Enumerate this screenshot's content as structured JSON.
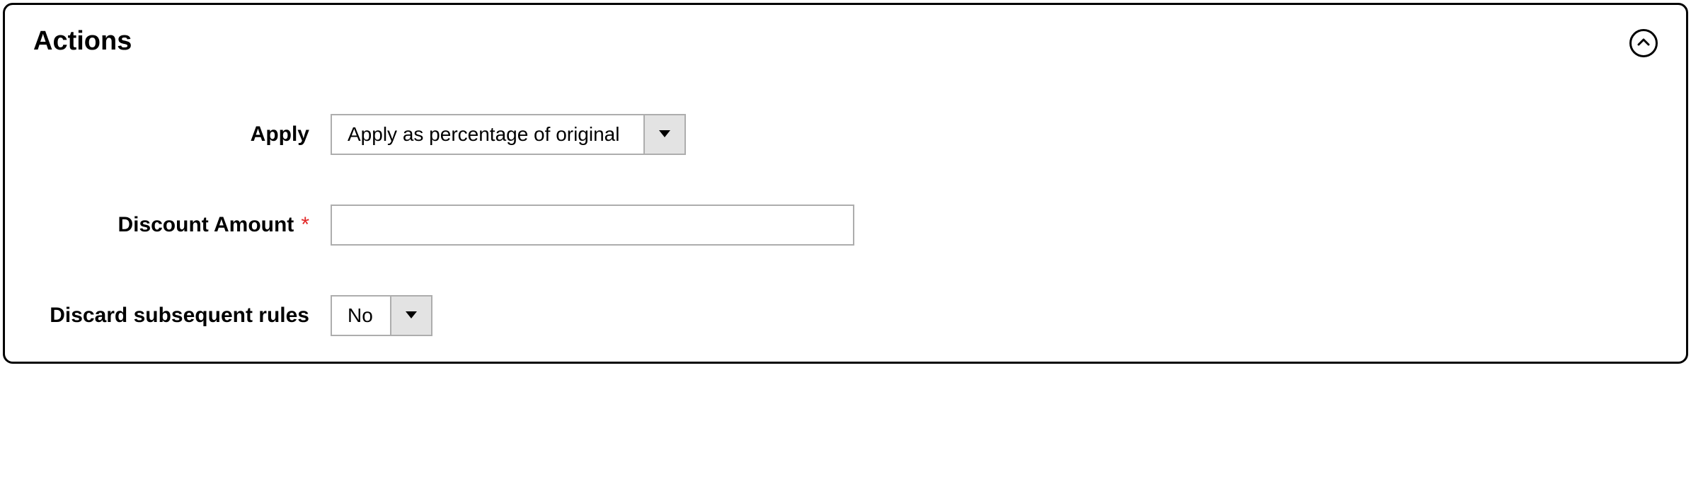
{
  "panel": {
    "title": "Actions"
  },
  "fields": {
    "apply": {
      "label": "Apply",
      "value": "Apply as percentage of original"
    },
    "discount_amount": {
      "label": "Discount Amount",
      "value": ""
    },
    "discard_rules": {
      "label": "Discard subsequent rules",
      "value": "No"
    }
  }
}
